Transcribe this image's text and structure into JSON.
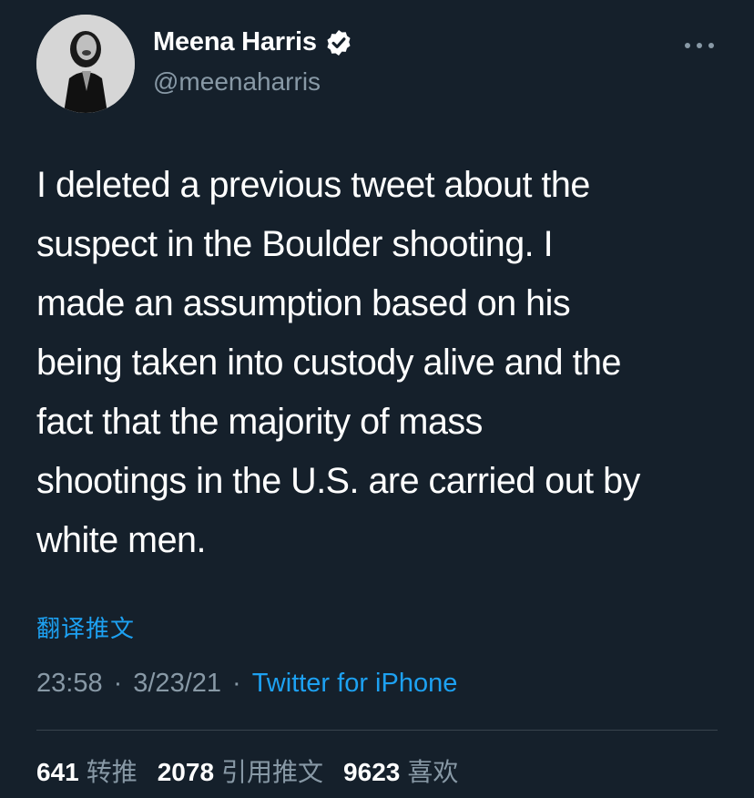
{
  "profile": {
    "display_name": "Meena Harris",
    "handle": "@meenaharris",
    "verified": true
  },
  "tweet": {
    "lines": [
      "I deleted a previous tweet about the",
      "suspect in the Boulder shooting. I",
      "made an assumption based on his",
      "being taken into custody alive and the",
      "fact that the majority of mass",
      "shootings in the U.S. are carried out by",
      "white men."
    ],
    "translate_label": "翻译推文",
    "time": "23:58",
    "date": "3/23/21",
    "source": "Twitter for iPhone",
    "separator": "·"
  },
  "stats": [
    {
      "count": "641",
      "label": "转推"
    },
    {
      "count": "2078",
      "label": "引用推文"
    },
    {
      "count": "9623",
      "label": "喜欢"
    }
  ],
  "icons": {
    "more": "more-horizontal-icon",
    "verified": "verified-badge-icon"
  },
  "colors": {
    "background": "#15202b",
    "primary_text": "#ffffff",
    "secondary_text": "#8899a6",
    "accent": "#1da1f2",
    "divider": "#38444d"
  }
}
